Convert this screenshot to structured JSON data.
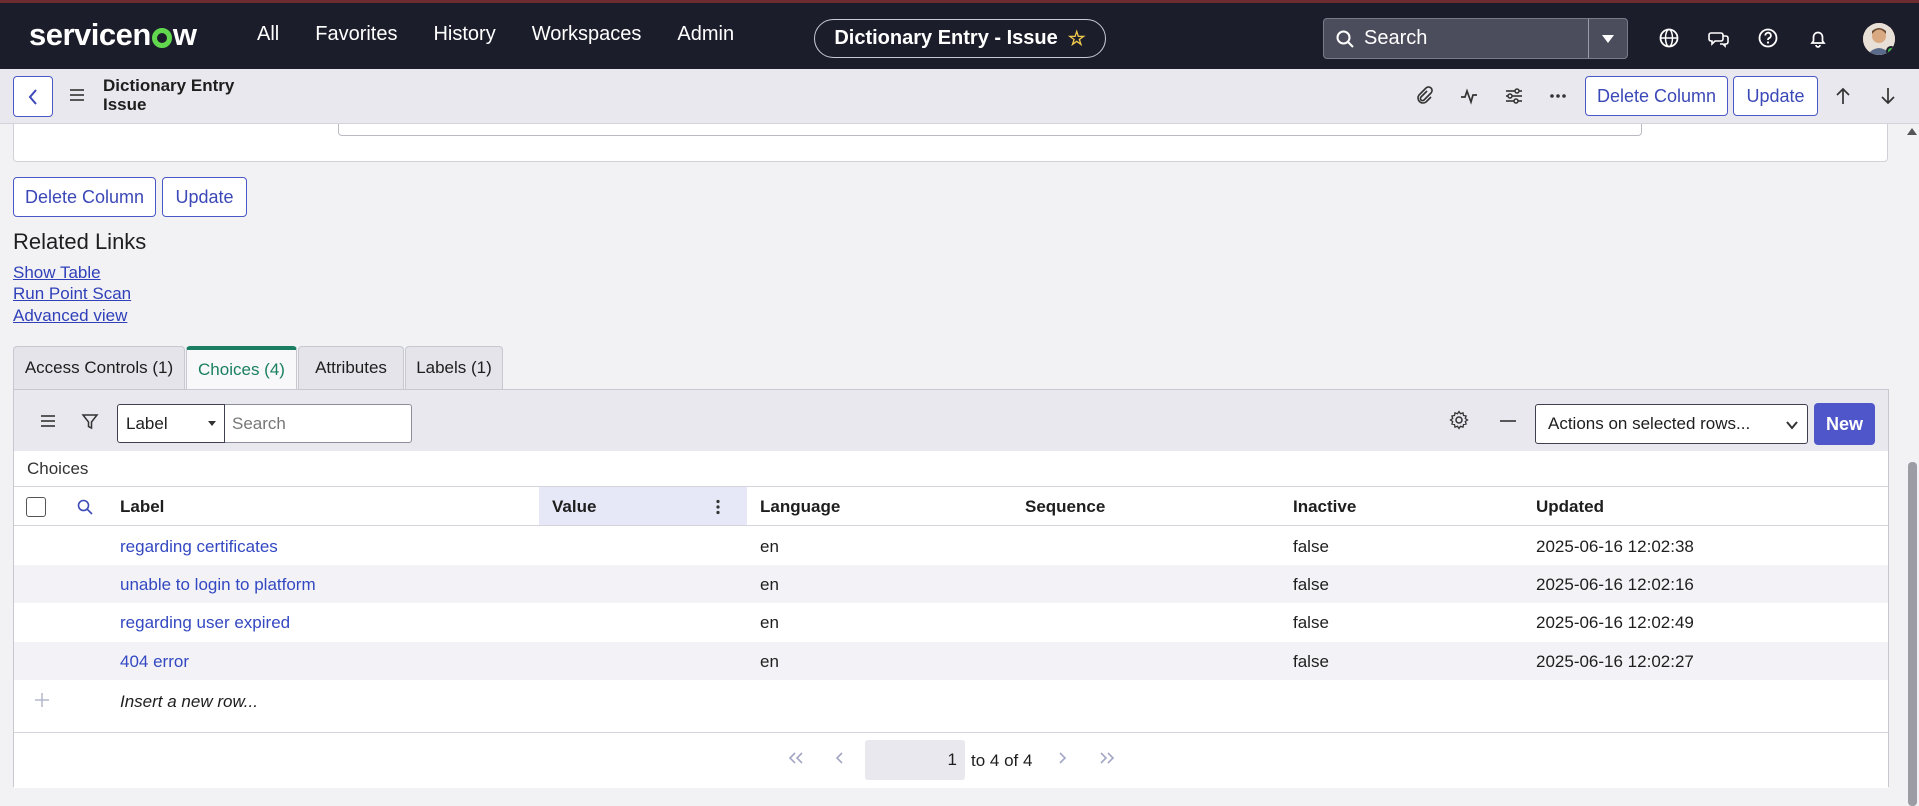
{
  "app": {
    "brand": "servicenow",
    "nav": [
      "All",
      "Favorites",
      "History",
      "Workspaces",
      "Admin"
    ],
    "context_title": "Dictionary Entry - Issue",
    "search_placeholder": "Search"
  },
  "form": {
    "title_line1": "Dictionary Entry",
    "title_line2": "Issue",
    "delete_label": "Delete Column",
    "update_label": "Update"
  },
  "related": {
    "title": "Related Links",
    "links": [
      "Show Table",
      "Run Point Scan",
      "Advanced view"
    ]
  },
  "tabs": [
    {
      "label": "Access Controls (1)"
    },
    {
      "label": "Choices (4)",
      "active": true
    },
    {
      "label": "Attributes"
    },
    {
      "label": "Labels (1)"
    }
  ],
  "list": {
    "filter_field": "Label",
    "search_placeholder": "Search",
    "actions_label": "Actions on selected rows...",
    "new_label": "New",
    "caption": "Choices",
    "columns": [
      "Label",
      "Value",
      "Language",
      "Sequence",
      "Inactive",
      "Updated"
    ],
    "rows": [
      {
        "label": "regarding certificates",
        "value": "",
        "language": "en",
        "sequence": "",
        "inactive": "false",
        "updated": "2025-06-16 12:02:38"
      },
      {
        "label": "unable to login to platform",
        "value": "",
        "language": "en",
        "sequence": "",
        "inactive": "false",
        "updated": "2025-06-16 12:02:16"
      },
      {
        "label": "regarding user expired",
        "value": "",
        "language": "en",
        "sequence": "",
        "inactive": "false",
        "updated": "2025-06-16 12:02:49"
      },
      {
        "label": "404 error",
        "value": "",
        "language": "en",
        "sequence": "",
        "inactive": "false",
        "updated": "2025-06-16 12:02:27"
      }
    ],
    "insert_label": "Insert a new row...",
    "page_value": "1",
    "page_of": "to 4 of 4"
  },
  "colors": {
    "topbar": "#1c1d2b",
    "accent": "#4f56c9",
    "active_tab": "#1a7f62",
    "link": "#3348c1"
  }
}
